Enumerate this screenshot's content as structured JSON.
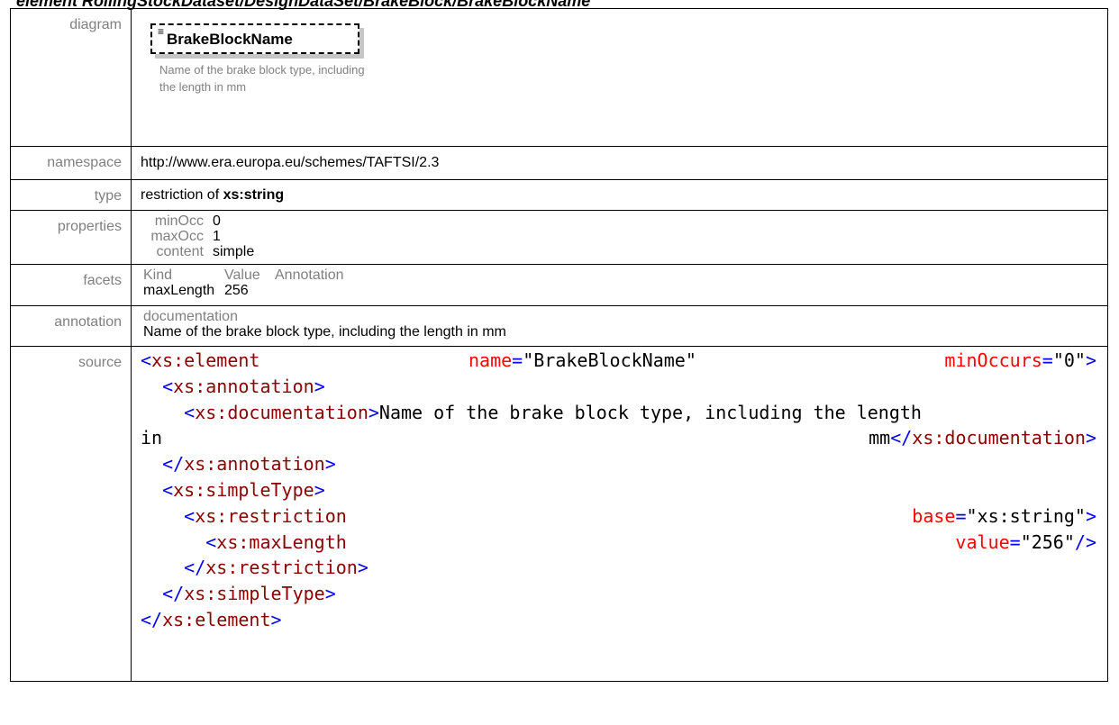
{
  "page_title": "element RollingStockDataset/DesignDataSet/BrakeBlock/BrakeBlockName",
  "rows": {
    "diagram": {
      "label": "diagram",
      "element_name": "BrakeBlockName",
      "description": "Name of the brake block type, including the length in mm"
    },
    "namespace": {
      "label": "namespace",
      "value": "http://www.era.europa.eu/schemes/TAFTSI/2.3"
    },
    "type": {
      "label": "type",
      "prefix": "restriction of ",
      "value": "xs:string"
    },
    "properties": {
      "label": "properties",
      "items": [
        {
          "key": "minOcc",
          "value": "0"
        },
        {
          "key": "maxOcc",
          "value": "1"
        },
        {
          "key": "content",
          "value": "simple"
        }
      ]
    },
    "facets": {
      "label": "facets",
      "headers": [
        "Kind",
        "Value",
        "Annotation"
      ],
      "rows": [
        {
          "kind": "maxLength",
          "value": "256",
          "annotation": ""
        }
      ]
    },
    "annotation": {
      "label": "annotation",
      "heading": "documentation",
      "text": "Name of the brake block type, including the length in mm"
    },
    "source": {
      "label": "source",
      "element_open": "xs:element",
      "name_attr": "name",
      "name_val": "\"BrakeBlockName\"",
      "minocc_attr": "minOccurs",
      "minocc_val": "\"0\"",
      "annotation_tag": "xs:annotation",
      "documentation_tag": "xs:documentation",
      "doc_text_1": "Name of the brake block type, including the length",
      "doc_text_2": "in",
      "doc_text_3": "mm",
      "simpletype_tag": "xs:simpleType",
      "restriction_tag": "xs:restriction",
      "base_attr": "base",
      "base_val": "\"xs:string\"",
      "maxlength_tag": "xs:maxLength",
      "value_attr": "value",
      "value_val": "\"256\""
    }
  }
}
